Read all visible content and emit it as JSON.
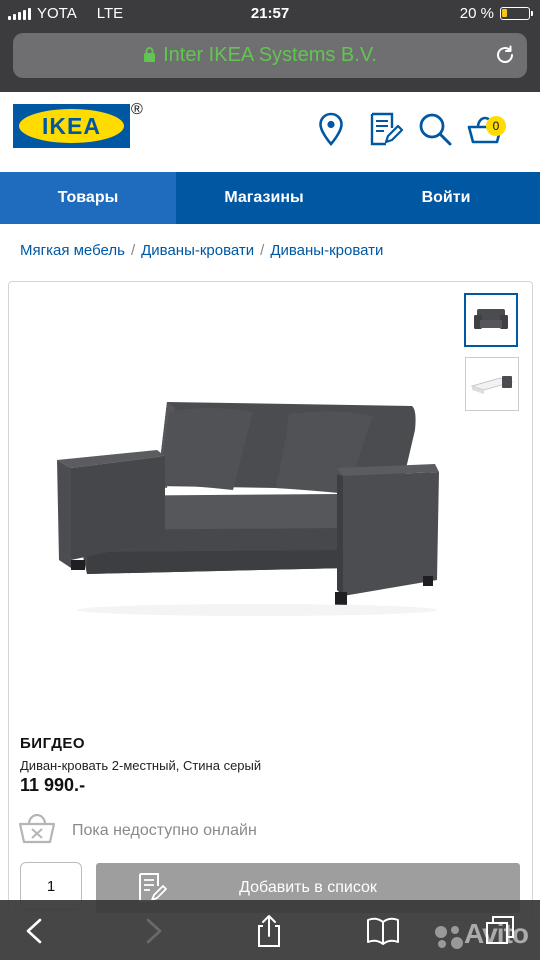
{
  "status_bar": {
    "carrier": "YOTA",
    "network": "LTE",
    "time": "21:57",
    "battery_percent": "20 %",
    "battery_level": 0.2
  },
  "browser": {
    "url_title": "Inter IKEA Systems B.V."
  },
  "header": {
    "logo_text": "IKEA",
    "logo_mark": "®",
    "cart_count": "0",
    "icons": [
      "location-pin-icon",
      "wishlist-icon",
      "search-icon",
      "cart-icon"
    ]
  },
  "nav": {
    "tabs": [
      {
        "label": "Товары"
      },
      {
        "label": "Магазины"
      },
      {
        "label": "Войти"
      }
    ]
  },
  "breadcrumbs": [
    {
      "label": "Мягкая мебель"
    },
    {
      "label": "Диваны-кровати"
    },
    {
      "label": "Диваны-кровати"
    }
  ],
  "product": {
    "name": "БИГДЕО",
    "description": "Диван-кровать 2-местный, Стина серый",
    "price": "11 990.-",
    "availability": "Пока недоступно онлайн",
    "quantity": "1",
    "add_button_label": "Добавить в список"
  },
  "watermark": {
    "text": "Avito"
  },
  "colors": {
    "ikea_blue": "#0058a3",
    "ikea_yellow": "#ffdb00",
    "url_green": "#62c552",
    "button_gray": "#9e9e9e"
  }
}
